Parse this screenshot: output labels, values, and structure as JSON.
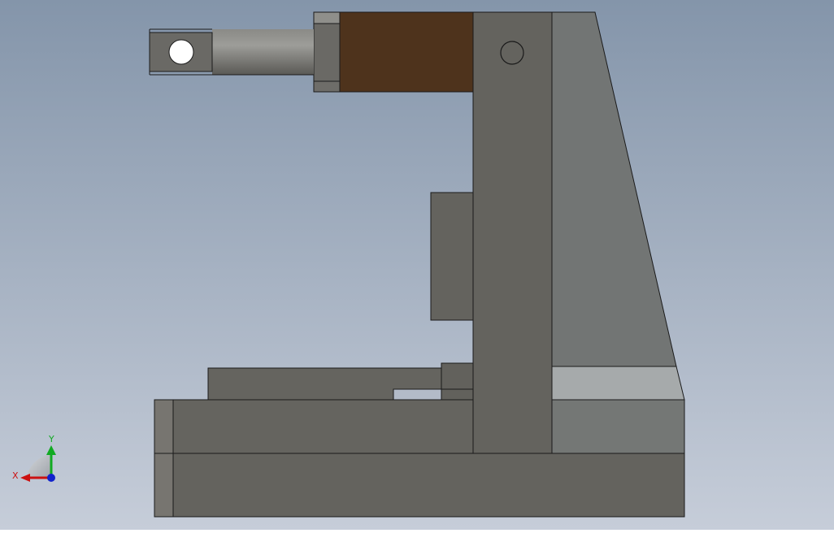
{
  "app": {
    "view": "cad-model-viewport"
  },
  "colors": {
    "bg_top": "#8898ac",
    "bg_bottom": "#c4cbd8",
    "steel": "#65645f",
    "steel_light": "#737674",
    "steel_highlight": "#a6aaab",
    "bronze": "#4e331c",
    "edge": "#1a1a1a",
    "axis_x": "#cc1111",
    "axis_y": "#11aa22",
    "axis_z": "#1122cc"
  },
  "triad": {
    "x_label": "X",
    "y_label": "Y",
    "x_icon": "x-axis-arrow",
    "y_icon": "y-axis-arrow",
    "z_icon": "z-axis-dot"
  }
}
